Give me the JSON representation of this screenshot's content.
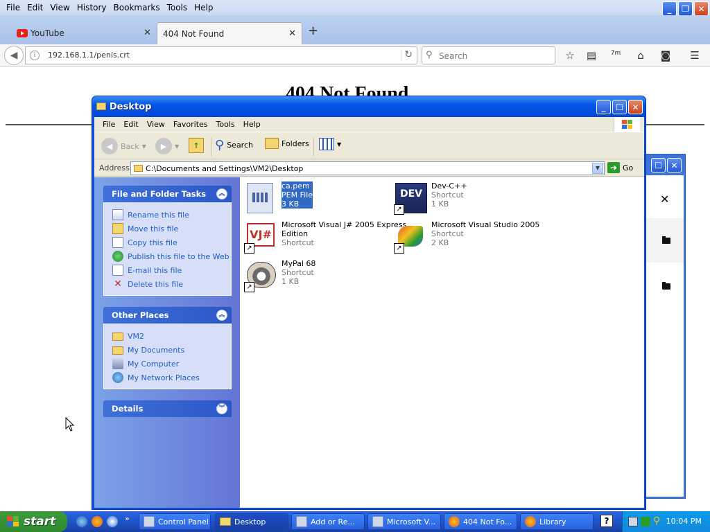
{
  "firefox": {
    "menu": [
      "File",
      "Edit",
      "View",
      "History",
      "Bookmarks",
      "Tools",
      "Help"
    ],
    "tabs": [
      {
        "label": "YouTube",
        "icon": "youtube-icon"
      },
      {
        "label": "404 Not Found",
        "icon": "none"
      }
    ],
    "url": "192.168.1.1/penis.crt",
    "search_placeholder": "Search",
    "page_heading": "404 Not Found",
    "extension_badge": "7m"
  },
  "explorer": {
    "title": "Desktop",
    "menu": [
      "File",
      "Edit",
      "View",
      "Favorites",
      "Tools",
      "Help"
    ],
    "toolbar": {
      "back": "Back",
      "search": "Search",
      "folders": "Folders"
    },
    "address_label": "Address",
    "address": "C:\\Documents and Settings\\VM2\\Desktop",
    "go_label": "Go",
    "file_tasks": {
      "title": "File and Folder Tasks",
      "items": [
        "Rename this file",
        "Move this file",
        "Copy this file",
        "Publish this file to the Web",
        "E-mail this file",
        "Delete this file"
      ]
    },
    "other_places": {
      "title": "Other Places",
      "items": [
        "VM2",
        "My Documents",
        "My Computer",
        "My Network Places"
      ]
    },
    "details": {
      "title": "Details"
    },
    "files": [
      {
        "name": "ca.pem",
        "type": "PEM File",
        "size": "3 KB",
        "selected": true
      },
      {
        "name": "Dev-C++",
        "type": "Shortcut",
        "size": "1 KB"
      },
      {
        "name": "Microsoft Visual J# 2005 Express",
        "name2": "Edition",
        "type": "Shortcut",
        "size": ""
      },
      {
        "name": "Microsoft Visual Studio 2005",
        "type": "Shortcut",
        "size": "2 KB"
      },
      {
        "name": "MyPal 68",
        "type": "Shortcut",
        "size": "1 KB"
      }
    ]
  },
  "taskbar": {
    "start": "start",
    "buttons": [
      "Control Panel",
      "Desktop",
      "Add or Re...",
      "Microsoft V...",
      "404 Not Fo...",
      "Library"
    ],
    "clock": "10:04 PM"
  },
  "colors": {
    "xp_blue": "#0a4fd9",
    "start_green": "#3c9a3c",
    "link_blue": "#215dc6",
    "selection": "#316ac5"
  }
}
